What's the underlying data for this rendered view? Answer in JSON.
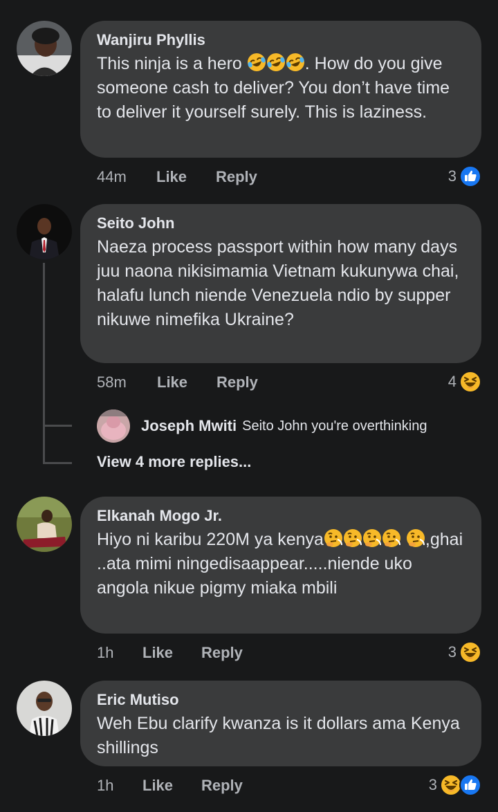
{
  "comments": [
    {
      "author": "Wanjiru Phyllis",
      "text_a": "This ninja is a hero ",
      "text_emoji": [
        "laughing-emoji",
        "laughing-emoji",
        "laughing-emoji"
      ],
      "text_b": ". How do you give someone cash to deliver? You don’t have time to deliver it yourself surely. This is laziness.",
      "time": "44m",
      "like": "Like",
      "reply": "Reply",
      "reaction_count": "3",
      "reactions": [
        "like-icon"
      ]
    },
    {
      "author": "Seito John",
      "text": "Naeza process passport within how many days juu naona nikisimamia Vietnam kukunywa chai, halafu lunch niende Venezuela ndio by supper nikuwe nimefika Ukraine?",
      "time": "58m",
      "like": "Like",
      "reply": "Reply",
      "reaction_count": "4",
      "reactions": [
        "haha-icon"
      ],
      "replies": {
        "reply_author": "Joseph Mwiti",
        "reply_text": "Seito John you're overthinking",
        "view_more": "View 4 more replies..."
      }
    },
    {
      "author": "Elkanah Mogo Jr.",
      "text_a": "Hiyo ni karibu  220M ya kenya",
      "text_emoji": [
        "thinking-emoji",
        "thinking-emoji",
        "thinking-emoji",
        "thinking-emoji",
        "thinking-emoji"
      ],
      "text_b": ",ghai ..ata mimi ningedisaappear.....niende uko angola nikue pigmy miaka mbili",
      "time": "1h",
      "like": "Like",
      "reply": "Reply",
      "reaction_count": "3",
      "reactions": [
        "haha-icon"
      ]
    },
    {
      "author": "Eric Mutiso",
      "text": "Weh Ebu clarify kwanza is it dollars ama Kenya shillings",
      "time": "1h",
      "like": "Like",
      "reply": "Reply",
      "reaction_count": "3",
      "reactions": [
        "haha-icon",
        "like-icon"
      ]
    }
  ],
  "colors": {
    "background": "#18191a",
    "bubble": "#3a3b3c",
    "text": "#e4e6eb",
    "secondary_text": "#b0b3b8",
    "like_blue": "#1877f2",
    "haha_yellow": "#f7b928"
  }
}
